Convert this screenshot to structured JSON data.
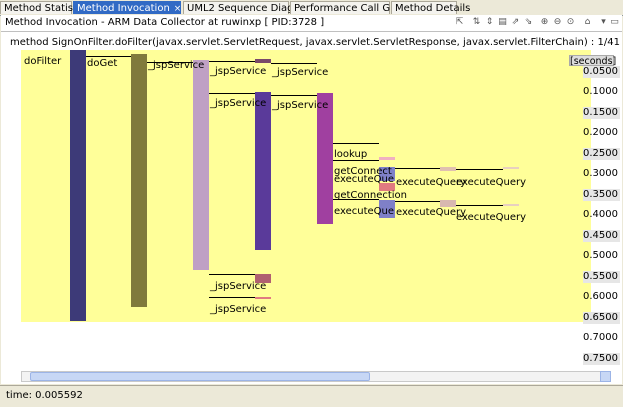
{
  "tabs": [
    {
      "label": "Method Statistics",
      "active": false
    },
    {
      "label": "Method Invocation",
      "active": true
    },
    {
      "label": "UML2 Sequence Diagram",
      "active": false
    },
    {
      "label": "Performance Call Graph",
      "active": false
    },
    {
      "label": "Method Details",
      "active": false
    }
  ],
  "tab_close_glyph": "×",
  "window_title": "Method Invocation - ARM Data Collector at ruwinxp [ PID:3728 ]",
  "method_line": "method SignOnFilter.doFilter(javax.servlet.ServletRequest, javax.servlet.ServletResponse, javax.servlet.FilterChain)  : 1/41",
  "axis": {
    "label": "[seconds]",
    "ticks": [
      "0.0500",
      "0.1000",
      "0.1500",
      "0.2000",
      "0.2500",
      "0.3000",
      "0.3500",
      "0.4000",
      "0.4500",
      "0.5000",
      "0.5500",
      "0.6000",
      "0.6500",
      "0.7000",
      "0.7500"
    ]
  },
  "methods": {
    "doFilter": "doFilter",
    "doGet": "doGet",
    "jsp1": "_jspService",
    "jsp2": "_jspService",
    "jsp3": "_jspService",
    "jsp4": "_jspService",
    "jsp5": "_jspService",
    "jsp6": "_jspService",
    "jsp7": "_jspService",
    "lookup": "lookup",
    "getConn1": "getConnect",
    "execQue1": "executeQue",
    "getConn2": "getConnection",
    "execQue2": "executeQue",
    "execQuery1": "executeQuery",
    "execQuery2": "executeQuery",
    "execQuery3": "executeQuery",
    "execQuery4": "executeQuery"
  },
  "colors": {
    "chart_bg": "#ffff99",
    "doFilter": "#3d3a78",
    "doGet": "#807a3c",
    "jspService": "#bfa0c4",
    "jspService2": "#5a3a9a",
    "jspService3": "#a040a0",
    "executeQuery": "#7f80c8",
    "getConnection": "#e07a80"
  },
  "toolbar_icons": [
    "export-icon",
    "filter-icon",
    "zoom-fit-icon",
    "expand-icon",
    "collapse-icon",
    "zoom-in-icon",
    "zoom-out-icon",
    "zoom-reset-icon",
    "home-icon",
    "view-menu-icon"
  ],
  "status_text": "time: 0.005592"
}
